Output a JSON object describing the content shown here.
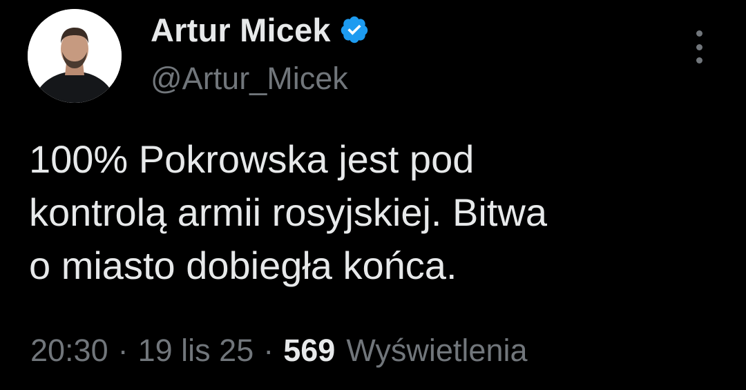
{
  "author": {
    "display_name": "Artur Micek",
    "handle": "@Artur_Micek",
    "verified_icon": "verified-badge-icon",
    "verified_color": "#1d9bf0"
  },
  "tweet": {
    "lines": [
      "100% Pokrowska jest pod",
      "kontrolą armii rosyjskiej. Bitwa",
      "o miasto dobiegła końca."
    ]
  },
  "meta": {
    "time": "20:30",
    "separator": "·",
    "date": "19 lis 25",
    "views_count": "569",
    "views_label": "Wyświetlenia"
  },
  "menu": {
    "icon": "more-vertical-icon"
  },
  "colors": {
    "background": "#000000",
    "primary_text": "#e7e9ea",
    "secondary_text": "#71767b"
  }
}
